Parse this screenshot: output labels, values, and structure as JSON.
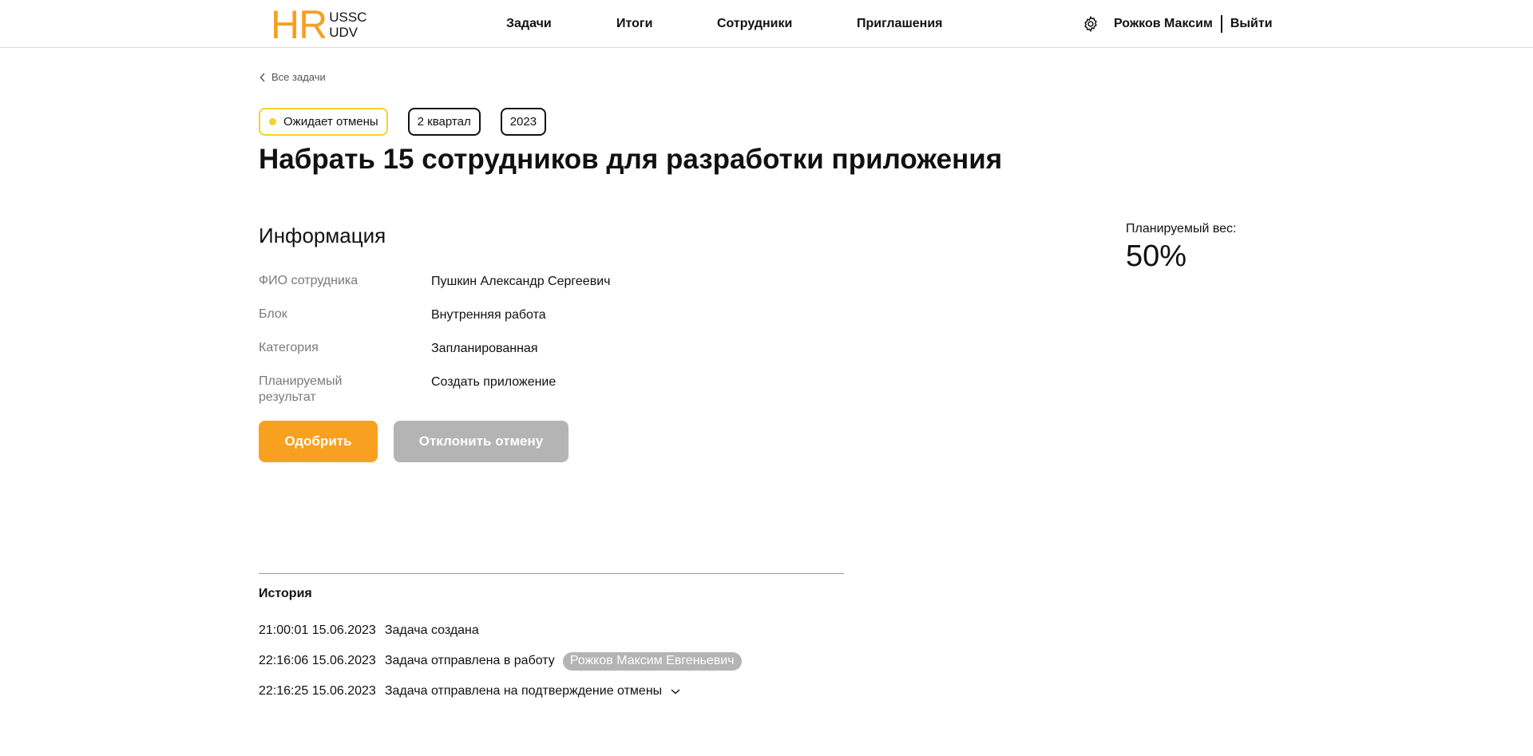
{
  "header": {
    "logo_main": "HR",
    "logo_line1": "USSC",
    "logo_line2": "UDV",
    "nav": [
      "Задачи",
      "Итоги",
      "Сотрудники",
      "Приглашения"
    ],
    "user_name": "Рожков Максим",
    "logout": "Выйти"
  },
  "breadcrumb": "Все задачи",
  "badges": {
    "status": "Ожидает отмены",
    "quarter": "2 квартал",
    "year": "2023"
  },
  "title": "Набрать 15 сотрудников для разработки приложения",
  "info": {
    "section_title": "Информация",
    "rows": [
      {
        "label": "ФИО сотрудника",
        "value": "Пушкин Александр Сергеевич"
      },
      {
        "label": "Блок",
        "value": "Внутренняя работа"
      },
      {
        "label": "Категория",
        "value": "Запланированная"
      },
      {
        "label": "Планируемый результат",
        "value": "Создать приложение"
      }
    ]
  },
  "actions": {
    "approve": "Одобрить",
    "reject": "Отклонить отмену"
  },
  "weight": {
    "label": "Планируемый вес:",
    "value": "50%"
  },
  "history": {
    "title": "История",
    "items": [
      {
        "time": "21:00:01 15.06.2023",
        "text": "Задача создана",
        "tag": ""
      },
      {
        "time": "22:16:06 15.06.2023",
        "text": "Задача отправлена в работу",
        "tag": "Рожков Максим Евгеньевич"
      },
      {
        "time": "22:16:25 15.06.2023",
        "text": "Задача отправлена на подтверждение отмены",
        "tag": ""
      }
    ]
  },
  "colors": {
    "accent": "#f8a020",
    "status_yellow": "#f5d22b",
    "disabled_gray": "#b4b4b4"
  },
  "icons": [
    "gear-icon",
    "chevron-left-icon",
    "chevron-down-icon"
  ]
}
